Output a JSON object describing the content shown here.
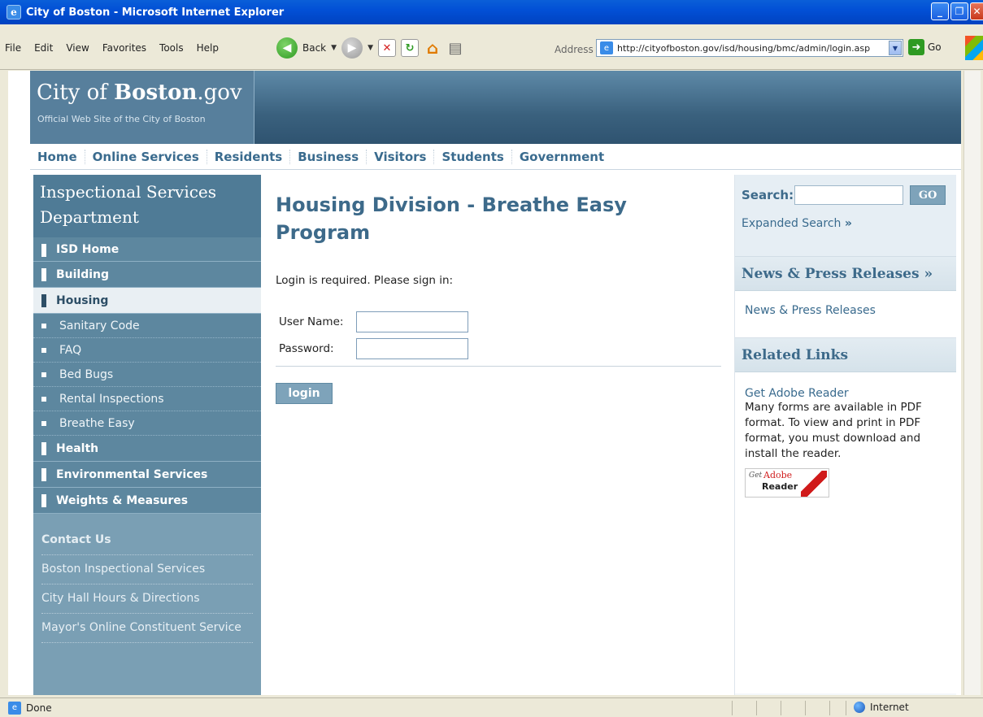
{
  "window": {
    "title": "City of Boston - Microsoft Internet Explorer"
  },
  "menu": [
    "File",
    "Edit",
    "View",
    "Favorites",
    "Tools",
    "Help"
  ],
  "toolbar": {
    "back_label": "Back",
    "address_label": "Address",
    "url": "http://cityofboston.gov/isd/housing/bmc/admin/login.asp",
    "go_label": "Go"
  },
  "status": {
    "text": "Done",
    "zone": "Internet"
  },
  "site": {
    "logo_city": "City of ",
    "logo_boston": "Boston",
    "logo_gov": ".gov",
    "tagline": "Official Web Site of the City of Boston"
  },
  "topnav": [
    "Home",
    "Online Services",
    "Residents",
    "Business",
    "Visitors",
    "Students",
    "Government"
  ],
  "sidebar": {
    "title": "Inspectional Services Department",
    "main_items": {
      "isd_home": "ISD Home",
      "building": "Building",
      "housing": "Housing",
      "health": "Health",
      "environmental": "Environmental Services",
      "weights": "Weights & Measures"
    },
    "sub_items": [
      "Sanitary Code",
      "FAQ",
      "Bed Bugs",
      "Rental Inspections",
      "Breathe Easy"
    ],
    "contact_heading": "Contact Us",
    "contact_links": [
      "Boston Inspectional Services",
      "City Hall Hours & Directions",
      "Mayor's Online Constituent Service"
    ]
  },
  "main": {
    "heading": "Housing Division - Breathe Easy Program",
    "intro": "Login is required. Please sign in:",
    "username_label": "User Name:",
    "password_label": "Password:",
    "login_label": "login"
  },
  "right": {
    "search_label": "Search:",
    "go_label": "GO",
    "expanded_label": "Expanded Search",
    "expanded_arrow": "»",
    "news_heading": "News & Press Releases",
    "news_arrow": "»",
    "news_link": "News & Press Releases",
    "related_heading": "Related Links",
    "adobe_link": "Get Adobe Reader",
    "adobe_desc": "Many forms are available in PDF format. To view and print in PDF format, you must download and install the reader.",
    "badge_get": "Get",
    "badge_adobe": "Adobe",
    "badge_reader": "Reader"
  }
}
